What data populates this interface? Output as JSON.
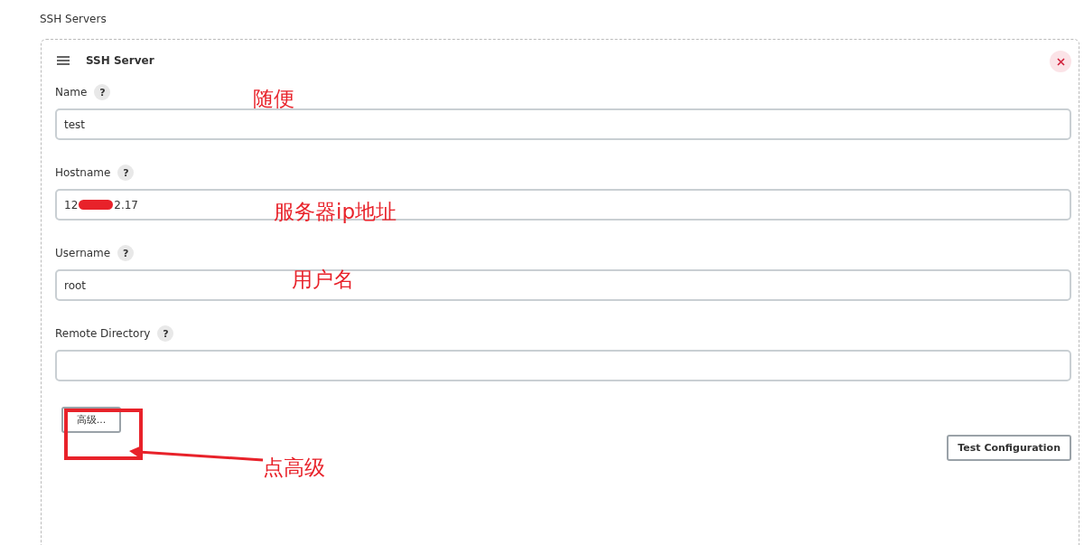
{
  "section_title": "SSH Servers",
  "server": {
    "title": "SSH Server",
    "fields": [
      {
        "label": "Name",
        "help": "?",
        "kind": "plain",
        "value": "test"
      },
      {
        "label": "Hostname",
        "help": "?",
        "kind": "redacted",
        "value_start": "12",
        "value_end": "2.17"
      },
      {
        "label": "Username",
        "help": "?",
        "kind": "plain",
        "value": "root"
      },
      {
        "label": "Remote Directory",
        "help": "?",
        "kind": "plain"
      }
    ],
    "advanced_button": "高级...",
    "test_button": "Test Configuration"
  },
  "annotations": [
    {
      "kind": "note",
      "text": "随便"
    },
    {
      "kind": "note",
      "text": "服务器ip地址"
    },
    {
      "kind": "note",
      "text": "用户名"
    },
    {
      "kind": "note",
      "text": "点高级"
    }
  ]
}
